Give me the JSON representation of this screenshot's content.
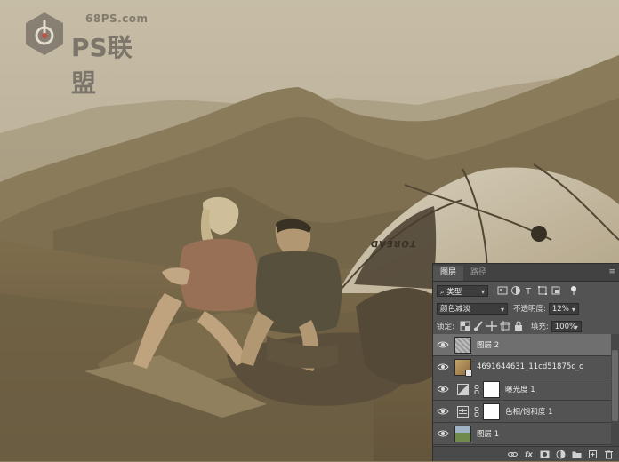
{
  "watermark": {
    "site": "68PS.com",
    "text": "PS联盟"
  },
  "tent": {
    "brand": "TOREAD"
  },
  "layers_panel": {
    "tabs": [
      {
        "label": "图层"
      },
      {
        "label": "路径"
      }
    ],
    "filter": {
      "kind_label": "类型"
    },
    "blend": {
      "mode": "颜色减淡",
      "opacity_label": "不透明度:",
      "opacity_value": "12%"
    },
    "lock": {
      "label": "锁定:",
      "fill_label": "填充:",
      "fill_value": "100%"
    },
    "layers": [
      {
        "name": "图层 2",
        "selected": true
      },
      {
        "name": "4691644631_11cd51875c_o",
        "selected": false
      },
      {
        "name": "曝光度 1",
        "selected": false
      },
      {
        "name": "色相/饱和度 1",
        "selected": false
      },
      {
        "name": "图层 1",
        "selected": false
      }
    ],
    "bottom": {
      "fx_label": "fx"
    }
  },
  "colors": {
    "panel_bg": "#535353",
    "selected_row": "#6f6f6f"
  }
}
